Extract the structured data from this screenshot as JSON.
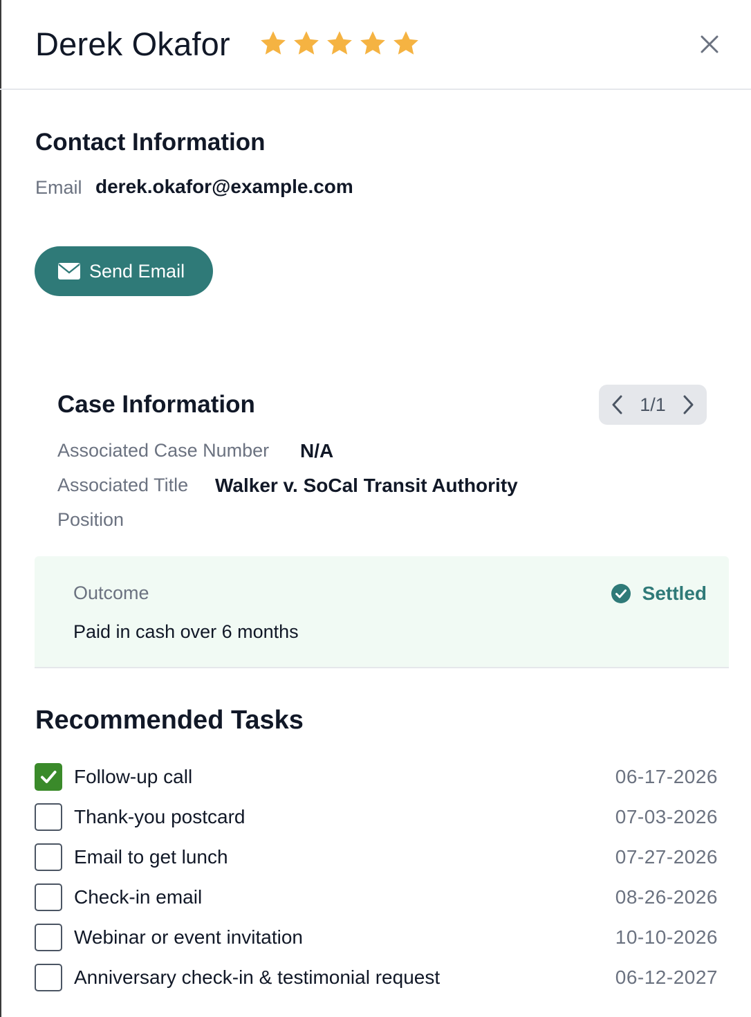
{
  "header": {
    "name": "Derek Okafor",
    "rating": 5,
    "rating_max": 5,
    "star_color": "#f5b342"
  },
  "contact": {
    "title": "Contact Information",
    "email_label": "Email",
    "email_value": "derek.okafor@example.com",
    "send_email_label": "Send Email",
    "button_color": "#2f7a78"
  },
  "case": {
    "title": "Case Information",
    "pager": "1/1",
    "case_number_label": "Associated Case Number",
    "case_number_value": "N/A",
    "title_label": "Associated Title",
    "title_value": "Walker v. SoCal Transit Authority",
    "position_label": "Position"
  },
  "outcome": {
    "label": "Outcome",
    "status": "Settled",
    "text": "Paid in cash over 6 months"
  },
  "tasks": {
    "title": "Recommended Tasks",
    "items": [
      {
        "label": "Follow-up call",
        "date": "06-17-2026",
        "checked": true
      },
      {
        "label": "Thank-you postcard",
        "date": "07-03-2026",
        "checked": false
      },
      {
        "label": "Email to get lunch",
        "date": "07-27-2026",
        "checked": false
      },
      {
        "label": "Check-in email",
        "date": "08-26-2026",
        "checked": false
      },
      {
        "label": "Webinar or event invitation",
        "date": "10-10-2026",
        "checked": false
      },
      {
        "label": "Anniversary check-in & testimonial request",
        "date": "06-12-2027",
        "checked": false
      }
    ]
  }
}
